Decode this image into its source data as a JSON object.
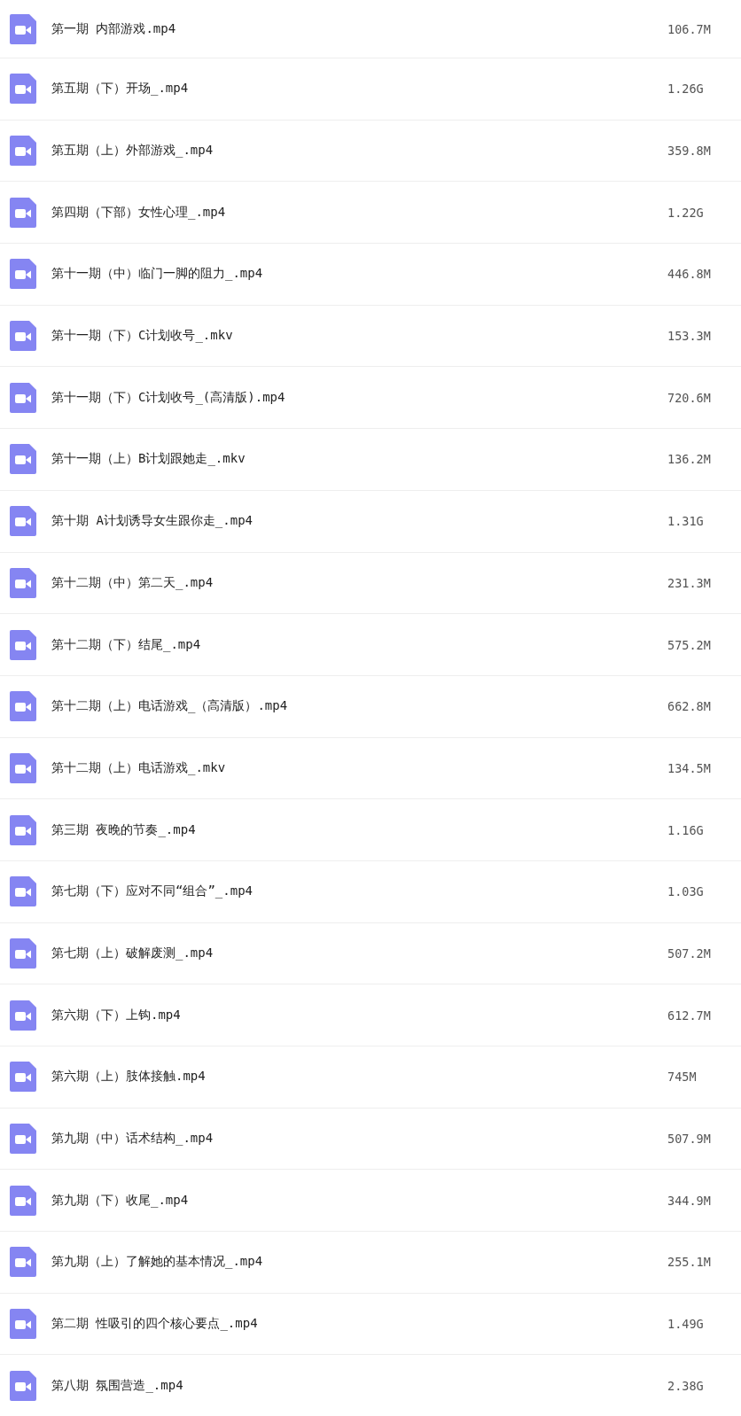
{
  "files": [
    {
      "name": "第一期 内部游戏.mp4",
      "size": "106.7M"
    },
    {
      "name": "第五期（下）开场_.mp4",
      "size": "1.26G"
    },
    {
      "name": "第五期（上）外部游戏_.mp4",
      "size": "359.8M"
    },
    {
      "name": "第四期（下部）女性心理_.mp4",
      "size": "1.22G"
    },
    {
      "name": "第十一期（中）临门一脚的阻力_.mp4",
      "size": "446.8M"
    },
    {
      "name": "第十一期（下）C计划收号_.mkv",
      "size": "153.3M"
    },
    {
      "name": "第十一期（下）C计划收号_(高清版).mp4",
      "size": "720.6M"
    },
    {
      "name": "第十一期（上）B计划跟她走_.mkv",
      "size": "136.2M"
    },
    {
      "name": "第十期 A计划诱导女生跟你走_.mp4",
      "size": "1.31G"
    },
    {
      "name": "第十二期（中）第二天_.mp4",
      "size": "231.3M"
    },
    {
      "name": "第十二期（下）结尾_.mp4",
      "size": "575.2M"
    },
    {
      "name": "第十二期（上）电话游戏_（高清版）.mp4",
      "size": "662.8M"
    },
    {
      "name": "第十二期（上）电话游戏_.mkv",
      "size": "134.5M"
    },
    {
      "name": "第三期 夜晚的节奏_.mp4",
      "size": "1.16G"
    },
    {
      "name": "第七期（下）应对不同“组合”_.mp4",
      "size": "1.03G"
    },
    {
      "name": "第七期（上）破解废测_.mp4",
      "size": "507.2M"
    },
    {
      "name": "第六期（下）上钩.mp4",
      "size": "612.7M"
    },
    {
      "name": "第六期（上）肢体接触.mp4",
      "size": "745M"
    },
    {
      "name": "第九期（中）话术结构_.mp4",
      "size": "507.9M"
    },
    {
      "name": "第九期（下）收尾_.mp4",
      "size": "344.9M"
    },
    {
      "name": "第九期（上）了解她的基本情况_.mp4",
      "size": "255.1M"
    },
    {
      "name": "第二期 性吸引的四个核心要点_.mp4",
      "size": "1.49G"
    },
    {
      "name": "第八期 氛围营造_.mp4",
      "size": "2.38G"
    }
  ]
}
